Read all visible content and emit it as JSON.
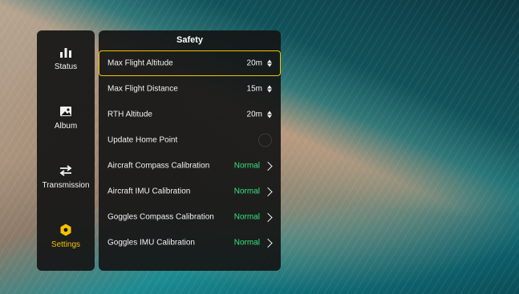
{
  "colors": {
    "accent": "#f3c200",
    "status_ok": "#38e27c",
    "panel_bg": "rgba(20,21,22,0.93)"
  },
  "sidebar": {
    "items": [
      {
        "label": "Status",
        "icon": "bar-chart-icon",
        "active": false
      },
      {
        "label": "Album",
        "icon": "image-icon",
        "active": false
      },
      {
        "label": "Transmission",
        "icon": "arrows-swap-icon",
        "active": false
      },
      {
        "label": "Settings",
        "icon": "hexagon-settings-icon",
        "active": true
      }
    ]
  },
  "panel": {
    "title": "Safety",
    "rows": [
      {
        "label": "Max Flight Altitude",
        "value": "20m",
        "control": "stepper",
        "selected": true
      },
      {
        "label": "Max Flight Distance",
        "value": "15m",
        "control": "stepper",
        "selected": false
      },
      {
        "label": "RTH Altitude",
        "value": "20m",
        "control": "stepper",
        "selected": false
      },
      {
        "label": "Update Home Point",
        "value": "",
        "control": "toggle-circle",
        "selected": false
      },
      {
        "label": "Aircraft Compass Calibration",
        "value": "Normal",
        "control": "chevron",
        "selected": false
      },
      {
        "label": "Aircraft IMU Calibration",
        "value": "Normal",
        "control": "chevron",
        "selected": false
      },
      {
        "label": "Goggles Compass Calibration",
        "value": "Normal",
        "control": "chevron",
        "selected": false
      },
      {
        "label": "Goggles IMU Calibration",
        "value": "Normal",
        "control": "chevron",
        "selected": false
      }
    ]
  }
}
